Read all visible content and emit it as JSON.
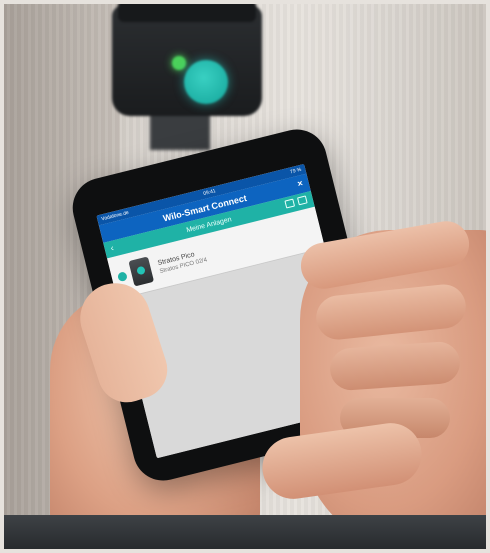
{
  "phone_screen": {
    "status_left": "Vodafone.de",
    "status_time": "09:41",
    "status_right": "79 %",
    "app_title": "Wilo-Smart Connect",
    "close_symbol": "×",
    "sub_title": "Meine Anlagen",
    "back_symbol": "‹",
    "device": {
      "name": "Stratos Pico",
      "subtitle": "Stratos PICO 02/4"
    }
  },
  "colors": {
    "app_bar": "#0d64c0",
    "sub_bar": "#1fb2a6",
    "pump_indicator": "#4bd15b",
    "pump_display": "#23c3b6"
  }
}
